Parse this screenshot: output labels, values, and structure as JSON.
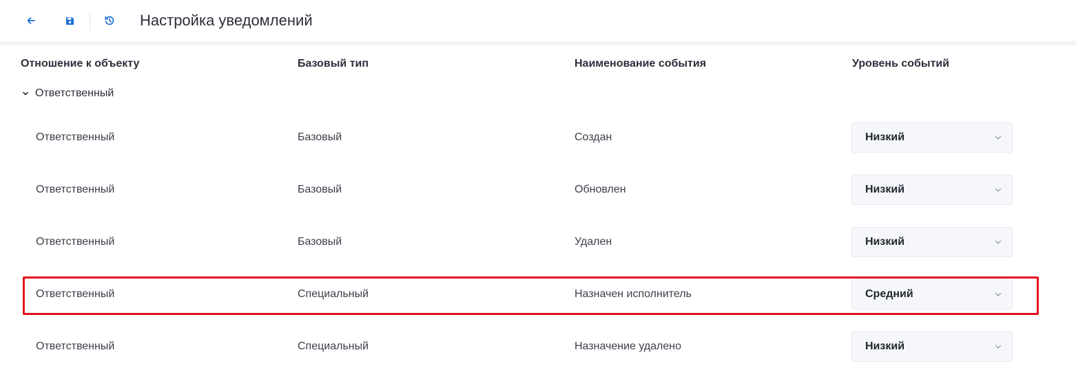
{
  "toolbar": {
    "title": "Настройка уведомлений",
    "icons": {
      "back": "arrow-left-icon",
      "save": "save-icon",
      "history": "history-icon"
    }
  },
  "table": {
    "columns": [
      "Отношение к объекту",
      "Базовый тип",
      "Наименование события",
      "Уровень событий"
    ],
    "group_label": "Ответственный",
    "rows": [
      {
        "relation": "Ответственный",
        "base_type": "Базовый",
        "event": "Создан",
        "level": "Низкий"
      },
      {
        "relation": "Ответственный",
        "base_type": "Базовый",
        "event": "Обновлен",
        "level": "Низкий"
      },
      {
        "relation": "Ответственный",
        "base_type": "Базовый",
        "event": "Удален",
        "level": "Низкий"
      },
      {
        "relation": "Ответственный",
        "base_type": "Специальный",
        "event": "Назначен исполнитель",
        "level": "Средний"
      },
      {
        "relation": "Ответственный",
        "base_type": "Специальный",
        "event": "Назначение удалено",
        "level": "Низкий"
      }
    ]
  },
  "colors": {
    "accent": "#1a6fd8",
    "highlight": "#e3101e",
    "select_bg": "#f5f7fb"
  }
}
